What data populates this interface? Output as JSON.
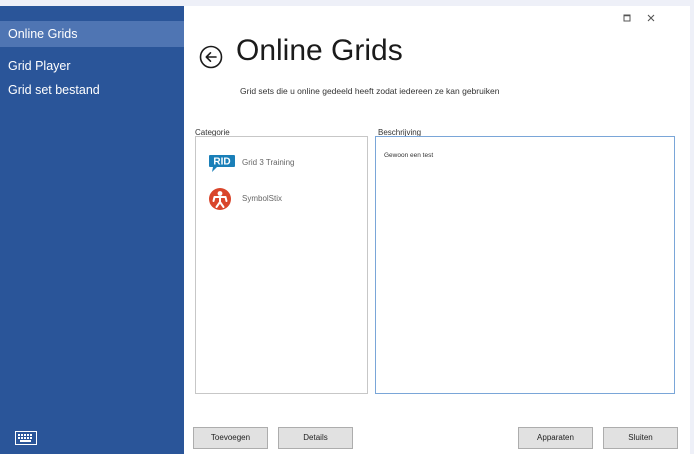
{
  "sidebar": {
    "items": [
      {
        "label": "Online Grids",
        "active": true
      },
      {
        "label": "Grid Player",
        "active": false
      },
      {
        "label": "Grid set bestand",
        "active": false
      }
    ],
    "keyboard_icon": "keyboard-icon"
  },
  "window_controls": {
    "maximize_icon": "maximize-icon",
    "close_icon": "close-icon"
  },
  "header": {
    "back_icon": "back-arrow-circle-icon",
    "title": "Online Grids",
    "subtitle": "Grid sets die u online gedeeld heeft zodat iedereen ze kan gebruiken"
  },
  "categories": {
    "label": "Categorie",
    "items": [
      {
        "name": "Grid 3 Training",
        "icon": "grid-logo-icon"
      },
      {
        "name": "SymbolStix",
        "icon": "symbolstix-logo-icon"
      }
    ]
  },
  "description": {
    "label": "Beschrijving",
    "text": "Gewoon een test"
  },
  "buttons": {
    "add": "Toevoegen",
    "details": "Details",
    "devices": "Apparaten",
    "close": "Sluiten"
  },
  "colors": {
    "sidebar_bg": "#2a5599",
    "sidebar_active": "#4f75b3",
    "description_border": "#7aa6d8",
    "grid_logo": "#1a7fb8",
    "symbolstix_logo": "#d9452b"
  }
}
